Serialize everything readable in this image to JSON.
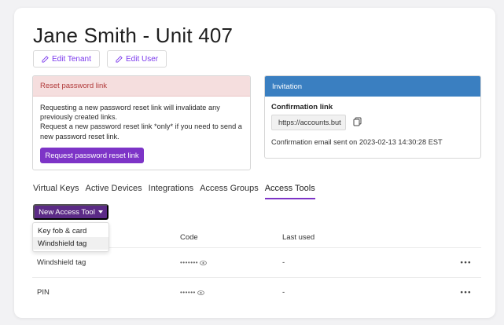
{
  "page": {
    "title": "Jane Smith - Unit 407",
    "edit_tenant": "Edit Tenant",
    "edit_user": "Edit User"
  },
  "reset": {
    "heading": "Reset password link",
    "line1": "Requesting a new password reset link will invalidate any",
    "line2": "previously created links.",
    "line3": "Request a new password reset link *only* if you need to send a",
    "line4": "new password reset link.",
    "button": "Request password reset link"
  },
  "invitation": {
    "heading": "Invitation",
    "label": "Confirmation link",
    "link_value": "https://accounts.but",
    "sent": "Confirmation email sent on 2023-02-13 14:30:28 EST"
  },
  "tabs": [
    {
      "label": "Virtual Keys"
    },
    {
      "label": "Active Devices"
    },
    {
      "label": "Integrations"
    },
    {
      "label": "Access Groups"
    },
    {
      "label": "Access Tools",
      "active": true
    }
  ],
  "new_tool": {
    "label": "New Access Tool",
    "options": [
      "Key fob & card",
      "Windshield tag"
    ]
  },
  "table": {
    "headers": [
      "",
      "Code",
      "Last used"
    ],
    "rows": [
      {
        "name": "Windshield tag",
        "code": "•••••••",
        "last_used": "-",
        "menu": "•••"
      },
      {
        "name": "PIN",
        "code": "••••••",
        "last_used": "-",
        "menu": "•••"
      }
    ]
  },
  "colors": {
    "accent": "#7d34c7",
    "invite_blue": "#3a7fc1",
    "reset_pink": "#f5dede"
  }
}
